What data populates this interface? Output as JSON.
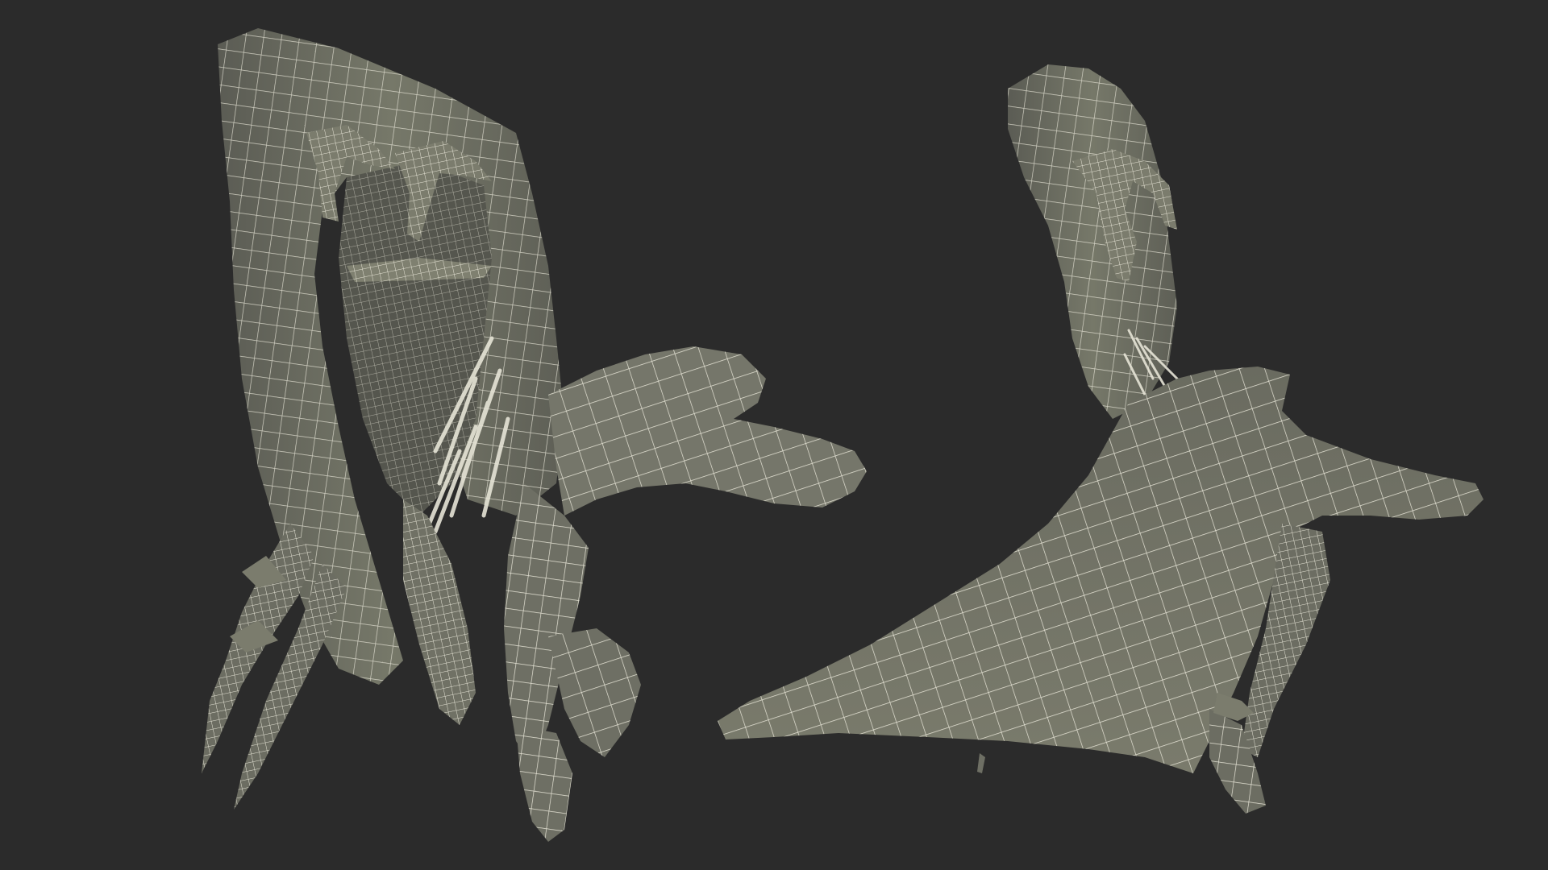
{
  "scene": {
    "background_color": "#2b2b2b",
    "mesh_fill_color": "#6e6f64",
    "mesh_shadow_color": "#50514a",
    "wireframe_color": "#e6e4d6",
    "models": [
      {
        "name": "wireframe-model-left"
      },
      {
        "name": "wireframe-model-right"
      }
    ]
  }
}
